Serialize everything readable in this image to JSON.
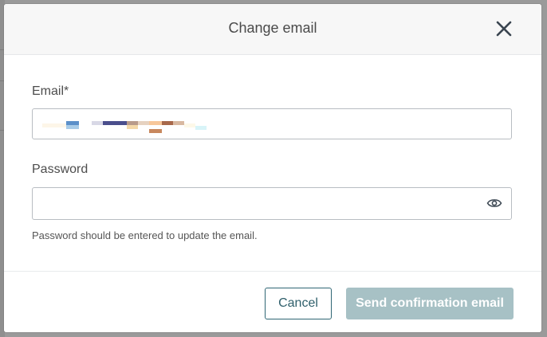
{
  "dialog": {
    "title": "Change email",
    "close_icon": "close-icon"
  },
  "form": {
    "email": {
      "label": "Email*",
      "value": "",
      "value_redacted": true
    },
    "password": {
      "label": "Password",
      "value": "",
      "toggle_icon": "eye-icon",
      "hint": "Password should be entered to update the email."
    }
  },
  "footer": {
    "cancel_label": "Cancel",
    "send_label": "Send confirmation email",
    "send_disabled": true
  },
  "colors": {
    "primary": "#2f6674",
    "primary_disabled": "#a7c1c5",
    "header_bg": "#f7f7f7",
    "overlay": "#9a9a9a"
  }
}
